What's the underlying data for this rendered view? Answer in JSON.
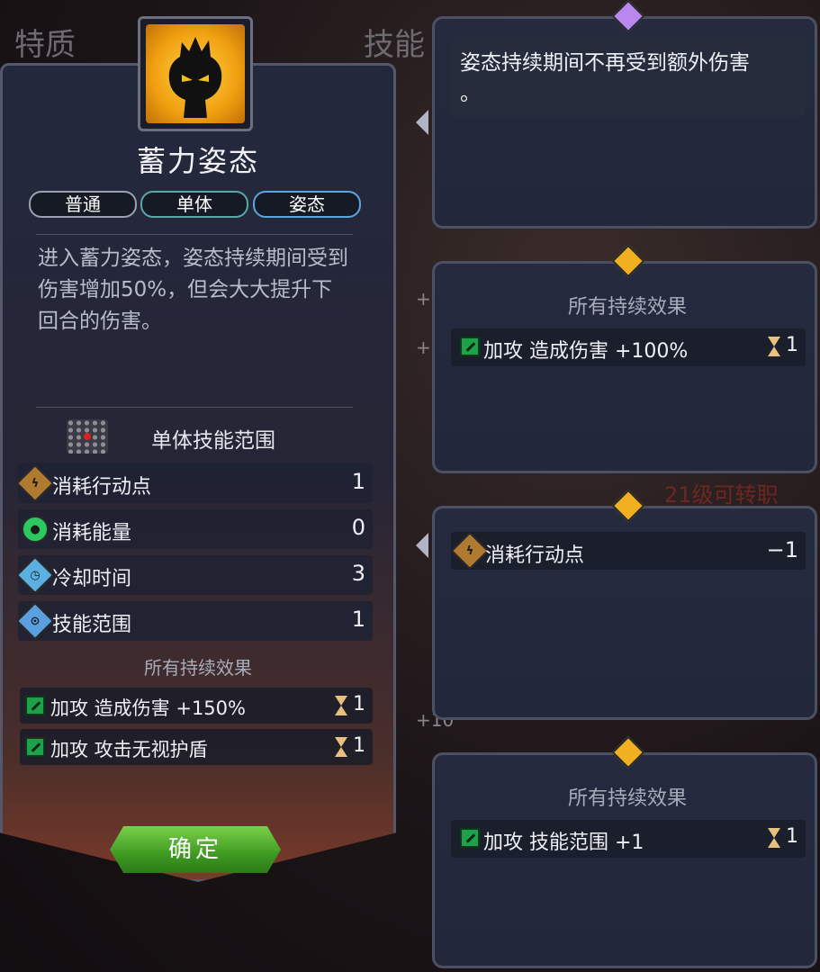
{
  "background": {
    "tab_traits": "特质",
    "tab_skills": "技能",
    "plus_marks": [
      "+",
      "+",
      "+10"
    ],
    "class_change_hint": "21级可转职"
  },
  "skill": {
    "name": "蓄力姿态",
    "tags": [
      "普通",
      "单体",
      "姿态"
    ],
    "description": "进入蓄力姿态，姿态持续期间受到伤害增加50%，但会大大提升下回合的伤害。",
    "range_label": "单体技能范围",
    "stats": [
      {
        "label": "消耗行动点",
        "value": "1",
        "icon": "action-point-icon"
      },
      {
        "label": "消耗能量",
        "value": "0",
        "icon": "energy-icon"
      },
      {
        "label": "冷却时间",
        "value": "3",
        "icon": "cooldown-icon"
      },
      {
        "label": "技能范围",
        "value": "1",
        "icon": "range-icon"
      }
    ],
    "effects_header": "所有持续效果",
    "effects": [
      {
        "text": "加攻 造成伤害 +150%",
        "duration": "1"
      },
      {
        "text": "加攻 攻击无视护盾",
        "duration": "1"
      }
    ],
    "confirm_label": "确定"
  },
  "tooltips": {
    "card1": {
      "text_line1": "姿态持续期间不再受到额外伤害",
      "text_line2": "。"
    },
    "card2": {
      "header": "所有持续效果",
      "effect_text": "加攻 造成伤害 +100%",
      "duration": "1"
    },
    "card3": {
      "label": "消耗行动点",
      "value": "−1"
    },
    "card4": {
      "header": "所有持续效果",
      "effect_text": "加攻 技能范围 +1",
      "duration": "1"
    }
  },
  "colors": {
    "confirm_green": "#3e9a22",
    "gem_purple": "#b888f0",
    "gem_gold": "#f0b020",
    "portrait_gold": "#f0a010"
  }
}
